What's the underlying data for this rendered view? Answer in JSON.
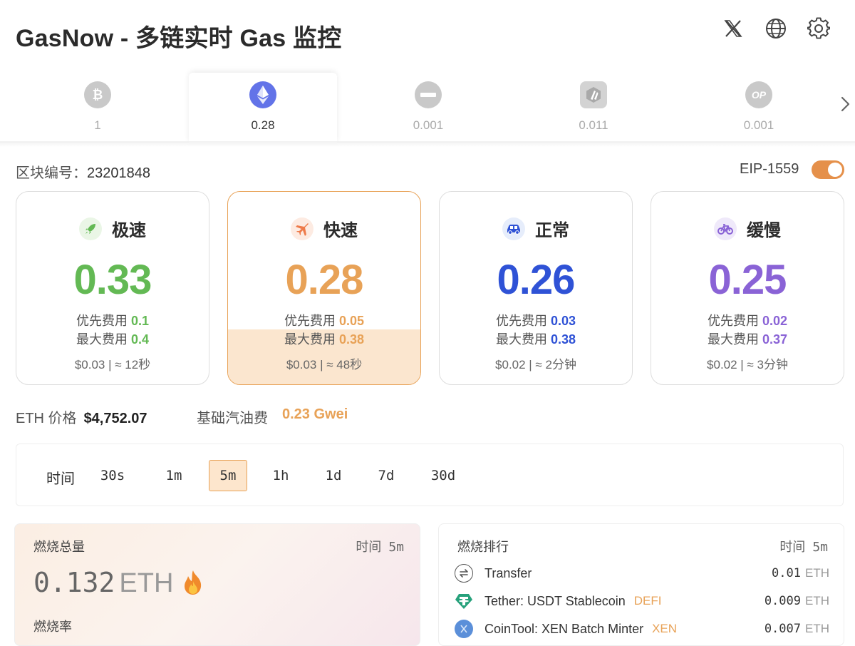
{
  "app": {
    "title": "GasNow - 多链实时 Gas 监控"
  },
  "header_icons": [
    "x-twitter-icon",
    "globe-icon",
    "gear-icon"
  ],
  "chains": [
    {
      "icon": "bitcoin-icon",
      "value": "1",
      "active": false
    },
    {
      "icon": "ethereum-icon",
      "value": "0.28",
      "active": true
    },
    {
      "icon": "chain-minus-icon",
      "value": "0.001",
      "active": false
    },
    {
      "icon": "arbitrum-icon",
      "value": "0.011",
      "active": false
    },
    {
      "icon": "optimism-icon",
      "logo_text": "OP",
      "value": "0.001",
      "active": false
    }
  ],
  "block": {
    "label": "区块编号：",
    "number": "23201848"
  },
  "eip": {
    "label": "EIP-1559",
    "enabled": true
  },
  "speeds": [
    {
      "name": "极速",
      "icon": "rocket-icon",
      "color": "#63b954",
      "icon_bg": "#eaf6e6",
      "value": "0.33",
      "priority_label": "优先费用",
      "priority": "0.1",
      "max_label": "最大费用",
      "max": "0.4",
      "footer": "$0.03 | ≈ 12秒"
    },
    {
      "name": "快速",
      "icon": "airplane-icon",
      "color": "#e8a257",
      "icon_bg": "#fdebe2",
      "value": "0.28",
      "priority_label": "优先费用",
      "priority": "0.05",
      "max_label": "最大费用",
      "max": "0.38",
      "footer": "$0.03 | ≈ 48秒"
    },
    {
      "name": "正常",
      "icon": "car-icon",
      "color": "#2f52d6",
      "icon_bg": "#e6edfb",
      "value": "0.26",
      "priority_label": "优先费用",
      "priority": "0.03",
      "max_label": "最大费用",
      "max": "0.38",
      "footer": "$0.02 | ≈ 2分钟"
    },
    {
      "name": "缓慢",
      "icon": "bicycle-icon",
      "color": "#8a63d6",
      "icon_bg": "#efe9fa",
      "value": "0.25",
      "priority_label": "优先费用",
      "priority": "0.02",
      "max_label": "最大费用",
      "max": "0.37",
      "footer": "$0.02 | ≈ 3分钟"
    }
  ],
  "price": {
    "label": "ETH 价格",
    "value": "$4,752.07"
  },
  "base_fee": {
    "label": "基础汽油费",
    "value": "0.23 Gwei"
  },
  "time_filter": {
    "label": "时间",
    "options": [
      "30s",
      "1m",
      "5m",
      "1h",
      "1d",
      "7d",
      "30d"
    ],
    "selected": "5m"
  },
  "burn_total": {
    "title": "燃烧总量",
    "time_label": "时间",
    "time_value": "5m",
    "amount": "0.132",
    "unit": "ETH",
    "icon": "fire-icon",
    "rate_label": "燃烧率"
  },
  "burn_rank": {
    "title": "燃烧排行",
    "time_label": "时间",
    "time_value": "5m",
    "rows": [
      {
        "icon": "transfer-icon",
        "name": "Transfer",
        "tag": "",
        "value": "0.01",
        "unit": "ETH"
      },
      {
        "icon": "tether-icon",
        "name": "Tether: USDT Stablecoin",
        "tag": "DEFI",
        "value": "0.009",
        "unit": "ETH"
      },
      {
        "icon": "xen-icon",
        "name": "CoinTool: XEN Batch Minter",
        "tag": "XEN",
        "value": "0.007",
        "unit": "ETH"
      }
    ]
  }
}
